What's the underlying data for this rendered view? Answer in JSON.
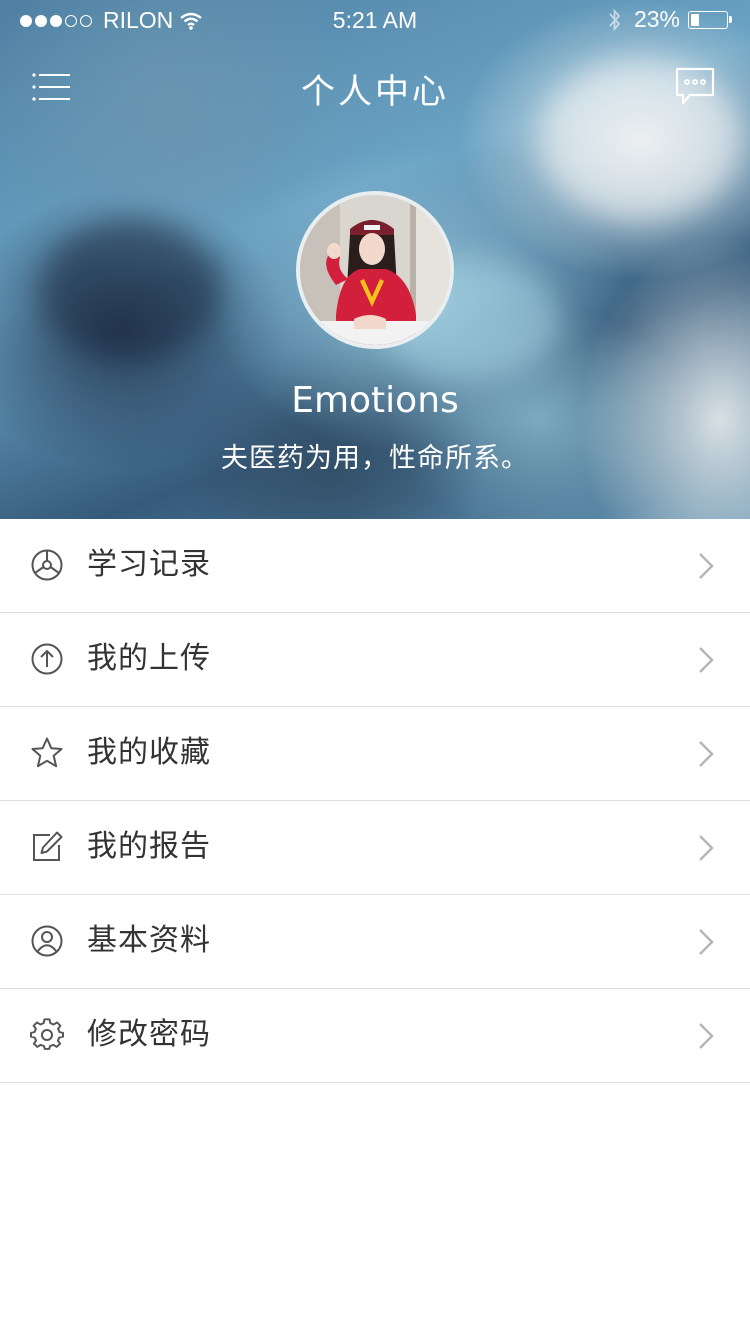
{
  "status_bar": {
    "carrier": "RILON",
    "time": "5:21 AM",
    "battery": "23%",
    "battery_level": 0.23
  },
  "nav": {
    "title": "个人中心",
    "left_icon": "menu-icon",
    "right_icon": "message-icon"
  },
  "profile": {
    "name": "Emotions",
    "motto": "夫医药为用，性命所系。"
  },
  "menu": {
    "items": [
      {
        "label": "学习记录",
        "icon": "steering-wheel-icon"
      },
      {
        "label": "我的上传",
        "icon": "upload-icon"
      },
      {
        "label": "我的收藏",
        "icon": "star-icon"
      },
      {
        "label": "我的报告",
        "icon": "edit-icon"
      },
      {
        "label": "基本资料",
        "icon": "user-icon"
      },
      {
        "label": "修改密码",
        "icon": "gear-icon"
      }
    ]
  },
  "colors": {
    "text": "#333333",
    "divider": "#dedede",
    "icon": "#555555",
    "chevron": "#b5b5b5"
  }
}
